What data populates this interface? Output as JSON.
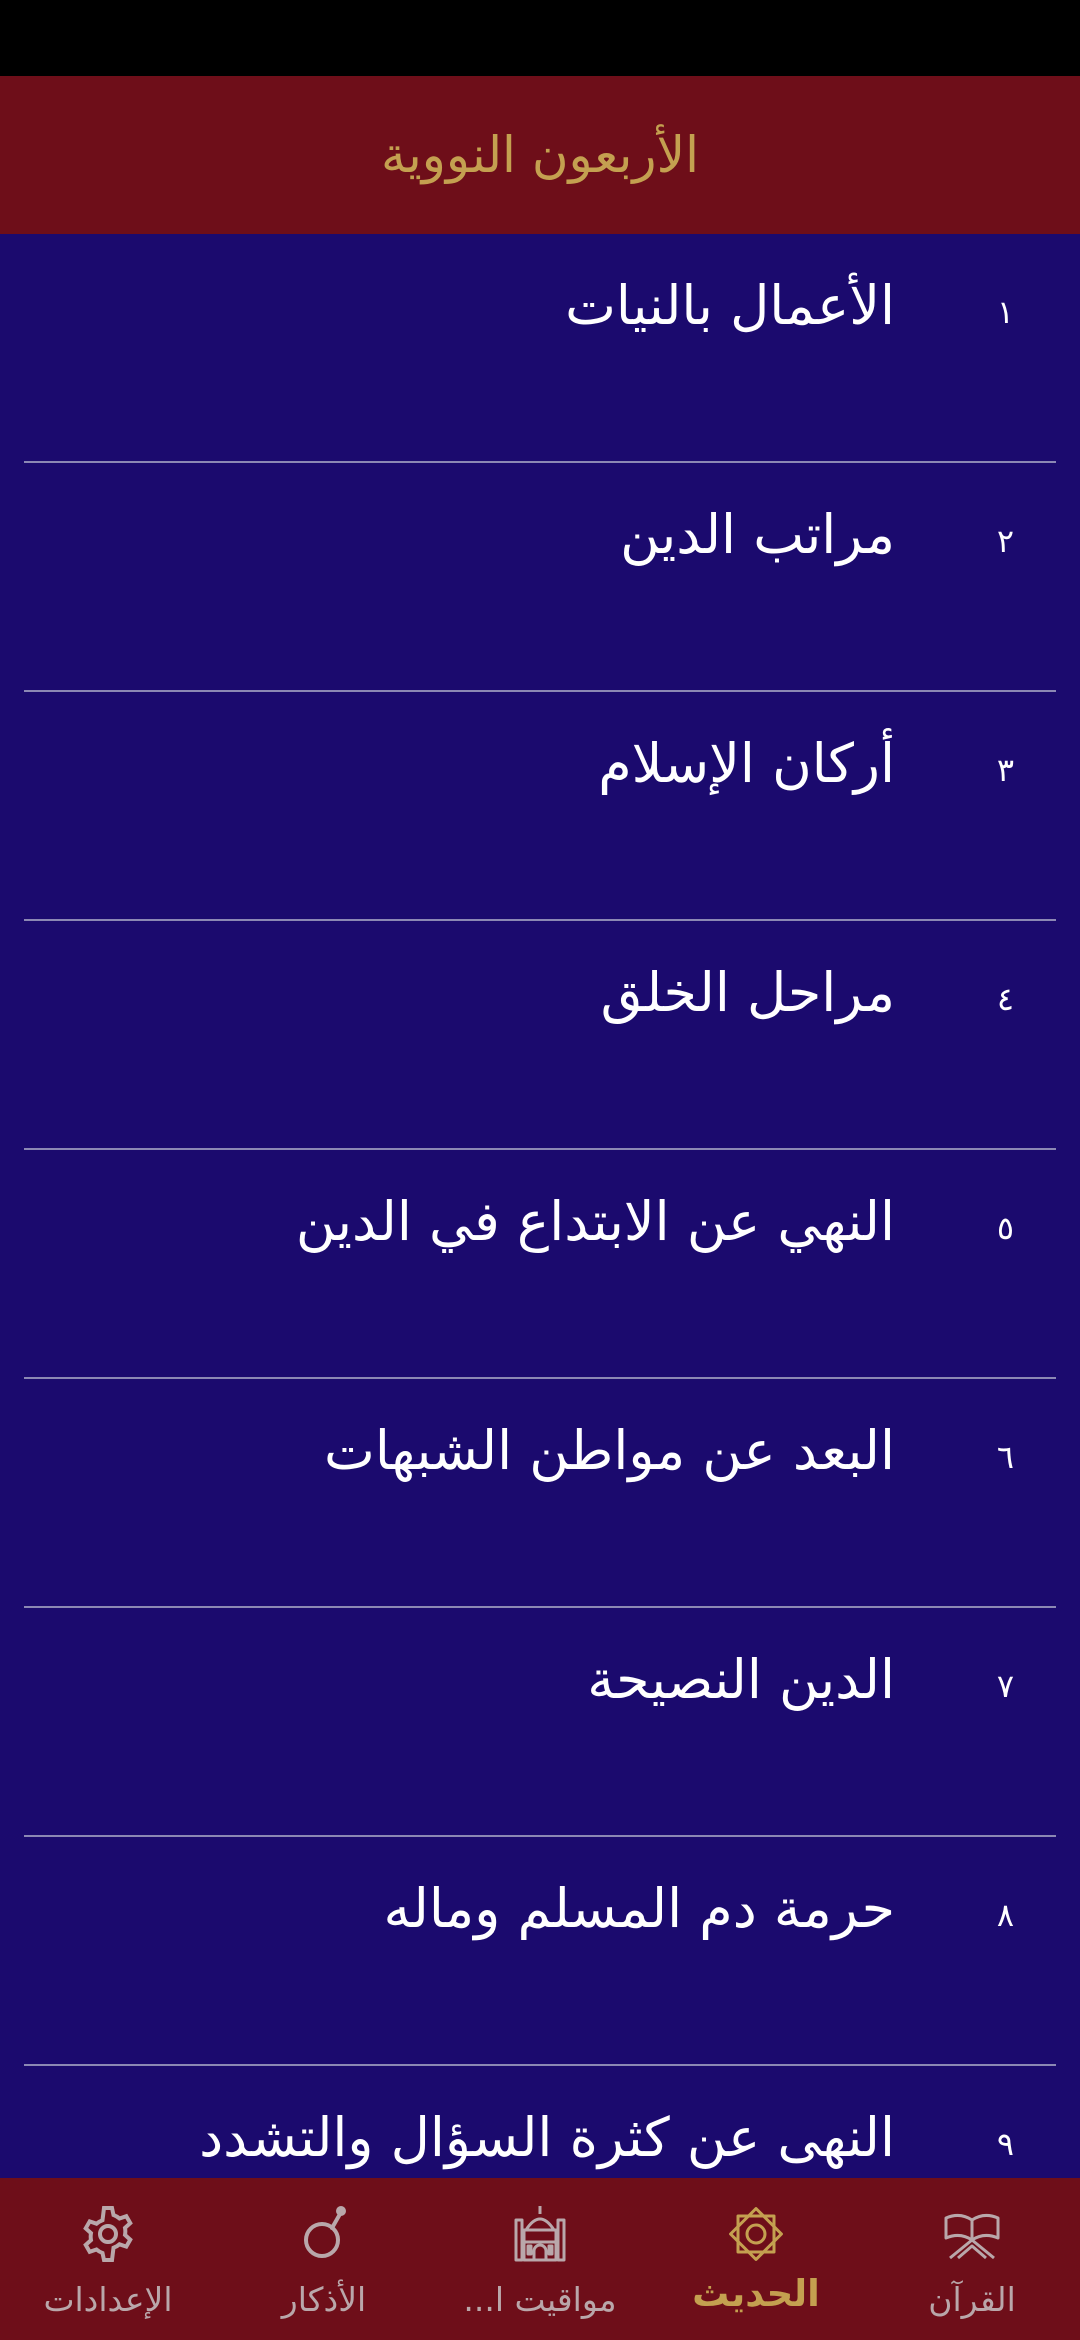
{
  "header": {
    "title": "الأربعون النووية"
  },
  "hadith_list": [
    {
      "number": "١",
      "title": "الأعمال بالنيات"
    },
    {
      "number": "٢",
      "title": "مراتب الدين"
    },
    {
      "number": "٣",
      "title": "أركان الإسلام"
    },
    {
      "number": "٤",
      "title": "مراحل الخلق"
    },
    {
      "number": "٥",
      "title": "النهي عن الابتداع في الدين"
    },
    {
      "number": "٦",
      "title": "البعد عن مواطن الشبهات"
    },
    {
      "number": "٧",
      "title": "الدين النصيحة"
    },
    {
      "number": "٨",
      "title": "حرمة دم المسلم وماله"
    },
    {
      "number": "٩",
      "title": "النهى عن كثرة السؤال والتشدد"
    }
  ],
  "bottom_nav": {
    "active": "hadith",
    "items": [
      {
        "id": "settings",
        "label": "الإعدادات",
        "icon": "gear-icon"
      },
      {
        "id": "adhkar",
        "label": "الأذكار",
        "icon": "prayer-beads-icon"
      },
      {
        "id": "prayer_times",
        "label": "مواقيت ا...",
        "icon": "mosque-icon"
      },
      {
        "id": "hadith",
        "label": "الحديث",
        "icon": "star-icon"
      },
      {
        "id": "quran",
        "label": "القرآن",
        "icon": "quran-book-icon"
      }
    ]
  },
  "colors": {
    "header_bg": "#6e0e19",
    "list_bg": "#1b0a6e",
    "accent_gold": "#c4a050",
    "inactive_nav": "#b9a7aa",
    "divider": "#8c88b4"
  }
}
